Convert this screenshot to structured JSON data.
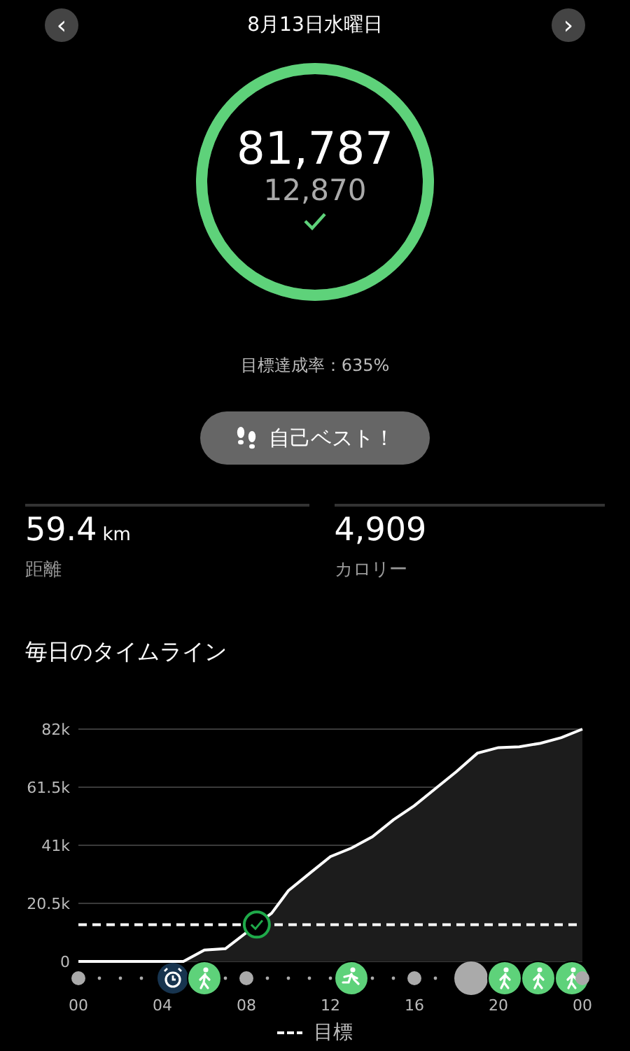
{
  "header": {
    "title": "8月13日水曜日",
    "prev_label": "‹",
    "next_label": "›"
  },
  "steps": {
    "value": "81,787",
    "goal": "12,870",
    "achieved": true,
    "level": 1
  },
  "achievement": "目標達成率：635%",
  "badge": {
    "label": "自己ベスト！"
  },
  "stats": [
    {
      "value": "59.4",
      "unit": "km",
      "label": "距離"
    },
    {
      "value": "4,909",
      "label": "カロリー"
    }
  ],
  "timeline": {
    "title": "毎日のタイムライン",
    "chart_data": {
      "type": "area",
      "x": [
        0,
        1,
        2,
        3,
        4,
        5,
        6,
        7,
        9.2,
        9.7,
        10,
        11,
        12,
        13,
        14,
        15,
        16,
        17,
        18,
        19,
        20,
        21,
        22,
        23,
        24
      ],
      "series": [
        {
          "color": "#ffffff",
          "values": [
            0,
            0,
            0,
            0,
            0,
            0,
            4000,
            4500,
            17000,
            22000,
            25000,
            31000,
            37000,
            40000,
            44000,
            50000,
            55000,
            61000,
            67000,
            73500,
            75500,
            75800,
            77000,
            79000,
            82000
          ]
        },
        {
          "name": "目標",
          "type": "line",
          "line_style": "dashed",
          "color": "#ffffff",
          "values": [
            13000,
            13000,
            13000,
            13000,
            13000,
            13000,
            13000,
            13000,
            13000,
            13000,
            13000,
            13000,
            13000,
            13000,
            13000,
            13000,
            13000,
            13000,
            13000,
            13000,
            13000,
            13000,
            13000,
            13000,
            13000
          ]
        }
      ],
      "grid": true,
      "ylim": [
        0,
        82000
      ],
      "xlim": [
        0,
        24
      ],
      "yticks": [
        {
          "value": 0,
          "label": "0"
        },
        {
          "value": 20500,
          "label": "20.5k"
        },
        {
          "value": 41000,
          "label": "41k"
        },
        {
          "value": 61500,
          "label": "61.5k"
        },
        {
          "value": 82000,
          "label": "82k"
        }
      ],
      "xticks": [
        {
          "value": 0,
          "label": "00"
        },
        {
          "value": 4,
          "label": "04"
        },
        {
          "value": 8,
          "label": "08"
        },
        {
          "value": 12,
          "label": "12"
        },
        {
          "value": 16,
          "label": "16"
        },
        {
          "value": 20,
          "label": "20"
        },
        {
          "value": 24,
          "label": "00"
        }
      ]
    },
    "events": [
      {
        "kind": "dot"
      },
      {
        "kind": "sleep"
      },
      {
        "kind": "walk"
      },
      {
        "kind": "dot"
      },
      {
        "kind": "run"
      },
      {
        "kind": "dot"
      },
      {
        "kind": "other"
      },
      {
        "kind": "walk"
      },
      {
        "kind": "walk"
      },
      {
        "kind": "walk"
      },
      {
        "kind": "dot"
      }
    ]
  }
}
